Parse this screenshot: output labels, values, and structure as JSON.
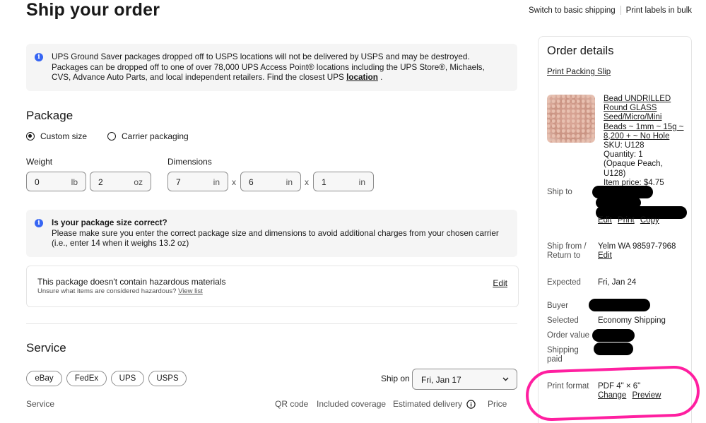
{
  "header": {
    "title": "Ship your order",
    "links": [
      "Switch to basic shipping",
      "Print labels in bulk"
    ]
  },
  "banner": {
    "text": "UPS Ground Saver packages dropped off to USPS locations will not be delivered by USPS and may be destroyed. Packages can be dropped off to one of over 78,000 UPS Access Point® locations including the UPS Store®, Michaels, CVS, Advance Auto Parts, and local independent retailers. Find the closest UPS",
    "link": "location",
    "end": "."
  },
  "package": {
    "title": "Package",
    "options": [
      "Custom size",
      "Carrier packaging"
    ],
    "selected": "Custom size",
    "weight_label": "Weight",
    "weight": [
      {
        "value": "0",
        "unit": "lb"
      },
      {
        "value": "2",
        "unit": "oz"
      }
    ],
    "dimensions_label": "Dimensions",
    "dimensions": [
      {
        "value": "7",
        "unit": "in"
      },
      {
        "value": "6",
        "unit": "in"
      },
      {
        "value": "1",
        "unit": "in"
      }
    ],
    "separator": "x",
    "size_notice": {
      "title": "Is your package size correct?",
      "body": "Please make sure you enter the correct package size and dimensions to avoid additional charges from your chosen carrier (i.e., enter 14 when it weighs 13.2 oz)"
    },
    "hazmat": {
      "title": "This package doesn't contain hazardous materials",
      "sub": "Unsure what items are considered hazardous?",
      "sub_link": "View list",
      "edit": "Edit"
    }
  },
  "service": {
    "title": "Service",
    "carriers": [
      "eBay",
      "FedEx",
      "UPS",
      "USPS"
    ],
    "ship_on_label": "Ship on",
    "ship_on_value": "Fri, Jan 17",
    "columns": [
      "Service",
      "QR code",
      "Included coverage",
      "Estimated delivery",
      "Price"
    ]
  },
  "order": {
    "title": "Order details",
    "print_packing_slip": "Print Packing Slip",
    "item": {
      "title": "Bead UNDRILLED Round GLASS Seed/Micro/Mini Beads ~ 1mm ~ 15g ~ 8,200 + ~ No Hole",
      "sku": "SKU: U128",
      "quantity": "Quantity: 1",
      "variant": "(Opaque Peach, U128)",
      "price": "Item price: $4.75"
    },
    "ship_to_label": "Ship to",
    "ship_to_actions": [
      "Edit",
      "Print",
      "Copy"
    ],
    "ship_from_label": "Ship from / Return to",
    "ship_from_value": "Yelm WA 98597-7968",
    "ship_from_action": "Edit",
    "expected_label": "Expected",
    "expected_value": "Fri, Jan 24",
    "buyer_label": "Buyer",
    "selected_label": "Selected",
    "selected_value": "Economy Shipping",
    "order_value_label": "Order value",
    "shipping_paid_label": "Shipping paid",
    "print_format_label": "Print format",
    "print_format_value": "PDF 4\" × 6\"",
    "print_format_actions": [
      "Change",
      "Preview"
    ]
  },
  "icons": {
    "info": "info-icon",
    "chevron": "chevron-down-icon",
    "help": "info-circle-icon"
  },
  "colors": {
    "info_blue": "#3665f3",
    "highlight": "#ff1fa0",
    "banner_bg": "#f5f5f5"
  }
}
